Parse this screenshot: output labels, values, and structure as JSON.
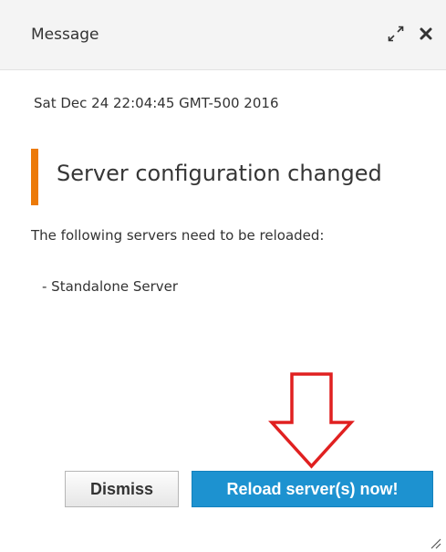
{
  "dialog": {
    "title": "Message",
    "timestamp": "Sat Dec 24 22:04:45 GMT-500 2016",
    "heading": "Server configuration changed",
    "description": "The following servers need to be reloaded:",
    "servers": [
      "- Standalone Server"
    ],
    "buttons": {
      "dismiss": "Dismiss",
      "reload": "Reload server(s) now!"
    }
  },
  "colors": {
    "accent": "#ec7a08",
    "primary_button": "#1d92d0",
    "annotation_arrow": "#e02020"
  },
  "icons": {
    "maximize": "maximize-icon",
    "close": "close-icon",
    "annotation": "arrow-down-icon",
    "resize": "resize-grip-icon"
  }
}
